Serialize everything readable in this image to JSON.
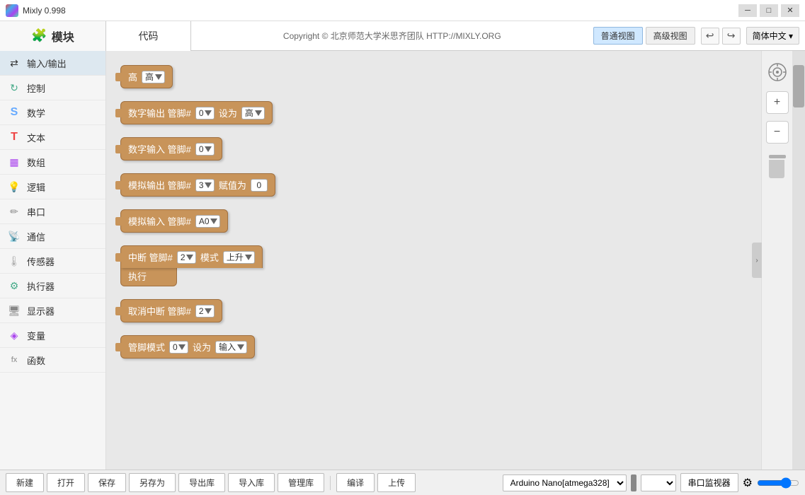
{
  "titleBar": {
    "title": "Mixly 0.998",
    "minimizeLabel": "─",
    "maximizeLabel": "□",
    "closeLabel": "✕"
  },
  "header": {
    "blocksTab": "模块",
    "codeTab": "代码",
    "copyright": "Copyright © 北京师范大学米思齐团队 HTTP://MIXLY.ORG",
    "normalView": "普通视图",
    "advancedView": "高级视图",
    "undoIcon": "↩",
    "redoIcon": "↪",
    "language": "简体中文 ▾"
  },
  "sidebar": {
    "items": [
      {
        "label": "输入/输出",
        "icon": "⇄",
        "active": true
      },
      {
        "label": "控制",
        "icon": "🔄",
        "active": false
      },
      {
        "label": "数学",
        "icon": "S",
        "active": false
      },
      {
        "label": "文本",
        "icon": "T",
        "active": false
      },
      {
        "label": "数组",
        "icon": "▦",
        "active": false
      },
      {
        "label": "逻辑",
        "icon": "💡",
        "active": false
      },
      {
        "label": "串口",
        "icon": "✏",
        "active": false
      },
      {
        "label": "通信",
        "icon": "📡",
        "active": false
      },
      {
        "label": "传感器",
        "icon": "🌡",
        "active": false
      },
      {
        "label": "执行器",
        "icon": "⚙",
        "active": false
      },
      {
        "label": "显示器",
        "icon": "🖥",
        "active": false
      },
      {
        "label": "变量",
        "icon": "◈",
        "active": false
      },
      {
        "label": "函数",
        "icon": "fx",
        "active": false
      }
    ]
  },
  "blocks": [
    {
      "id": "block-high",
      "type": "value-only",
      "label": "高",
      "hasDropdown": true,
      "value": "高"
    },
    {
      "id": "block-digital-out",
      "type": "digital-out",
      "label1": "数字输出 管脚#",
      "pin": "0",
      "label2": "设为",
      "value": "高",
      "hasDropdownPin": true,
      "hasDropdownValue": true
    },
    {
      "id": "block-digital-in",
      "type": "digital-in",
      "label1": "数字输入 管脚#",
      "pin": "0",
      "hasDropdownPin": true
    },
    {
      "id": "block-analog-out",
      "type": "analog-out",
      "label1": "模拟输出 管脚#",
      "pin": "3",
      "label2": "赋值为",
      "value": "0",
      "hasDropdownPin": true
    },
    {
      "id": "block-analog-in",
      "type": "analog-in",
      "label1": "模拟输入 管脚#",
      "pin": "A0",
      "hasDropdownPin": true
    },
    {
      "id": "block-interrupt",
      "type": "interrupt",
      "label1": "中断 管脚#",
      "pin": "2",
      "label2": "模式",
      "mode": "上升",
      "execLabel": "执行",
      "hasDropdownPin": true,
      "hasDropdownMode": true
    },
    {
      "id": "block-cancel-interrupt",
      "type": "cancel-interrupt",
      "label1": "取消中断 管脚#",
      "pin": "2",
      "hasDropdownPin": true
    },
    {
      "id": "block-pin-mode",
      "type": "pin-mode",
      "label1": "管脚模式",
      "pin": "0",
      "label2": "设为",
      "mode": "输入",
      "hasDropdownPin": true,
      "hasDropdownMode": true
    }
  ],
  "toolbar": {
    "newLabel": "新建",
    "openLabel": "打开",
    "saveLabel": "保存",
    "saveAsLabel": "另存为",
    "exportLibLabel": "导出库",
    "importLibLabel": "导入库",
    "manageLibLabel": "管理库",
    "compileLabel": "编译",
    "uploadLabel": "上传",
    "board": "Arduino Nano[atmega328]",
    "port": "",
    "monitorLabel": "串口监视器",
    "gearIcon": "⚙"
  }
}
